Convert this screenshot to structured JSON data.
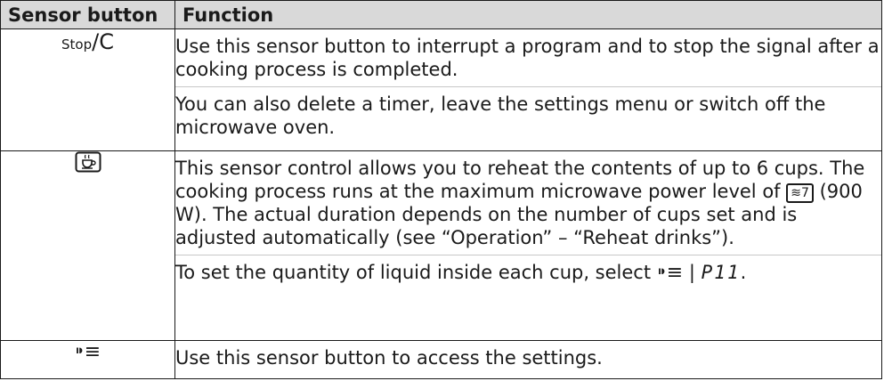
{
  "table": {
    "headers": [
      "Sensor button",
      "Function"
    ],
    "rows": [
      {
        "symbol_small": "Stop",
        "symbol_big": "/C",
        "paragraphs": [
          "Use this sensor button to interrupt a program and to stop the signal after a cooking process is completed.",
          "You can also delete a timer, leave the settings menu or switch off the microwave oven."
        ]
      },
      {
        "symbol_icon": "cup-icon",
        "para1_a": "This sensor control allows you to reheat the contents of up to 6 cups. The cooking process runs at the maximum microwave power level of",
        "power_badge": "≋7",
        "para1_b": "(900 W). The actual duration depends on the number of cups set and is adjusted automatically (see “Operation” – “Reheat drinks”).",
        "para2_a": "To set the quantity of liquid inside each cup, select",
        "settings_glyph": "⁍≡",
        "separator": "|",
        "display_code": "P11",
        "para2_end": "."
      },
      {
        "symbol_glyph": "⁍≡",
        "paragraphs": [
          "Use this sensor button to access the settings."
        ]
      }
    ]
  }
}
